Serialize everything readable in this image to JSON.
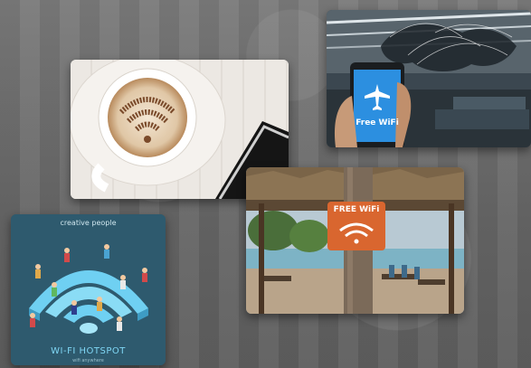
{
  "photo_plane": {
    "sign_text": "Free WiFi"
  },
  "photo_beach": {
    "sign_text": "FREE WiFi"
  },
  "illustration_hotspot": {
    "heading": "creative people",
    "title": "WI-FI HOTSPOT",
    "subtitle": "wifi anywhere"
  },
  "colors": {
    "background": "#6d6d6d",
    "hotspot_bg": "#2e5a6e",
    "wifi_symbol": "#6fd0f2",
    "sign_orange": "#d9662f",
    "phone_blue": "#2c8fe0"
  }
}
